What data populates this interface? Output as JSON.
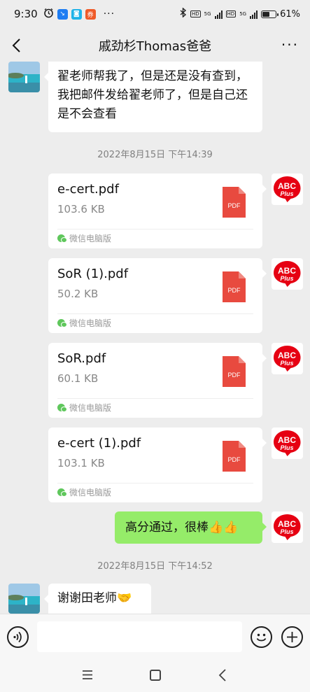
{
  "status_bar": {
    "time": "9:30",
    "battery_text": "61%",
    "battery_level": 0.61,
    "network_label": "5G",
    "hd_label": "HD"
  },
  "header": {
    "title": "戚劲杉Thomas爸爸"
  },
  "messages": {
    "first_text": "翟老师帮我了，但是还是没有查到，我把邮件发给翟老师了，但是自己还是不会查看",
    "time_1": "2022年8月15日 下午14:39",
    "files": [
      {
        "name": "e-cert.pdf",
        "size": "103.6 KB",
        "source": "微信电脑版",
        "icon_label": "PDF"
      },
      {
        "name": "SoR (1).pdf",
        "size": "50.2 KB",
        "source": "微信电脑版",
        "icon_label": "PDF"
      },
      {
        "name": "SoR.pdf",
        "size": "60.1 KB",
        "source": "微信电脑版",
        "icon_label": "PDF"
      },
      {
        "name": "e-cert (1).pdf",
        "size": "103.1 KB",
        "source": "微信电脑版",
        "icon_label": "PDF"
      }
    ],
    "sent_text": "高分通过，很棒👍👍",
    "time_2": "2022年8月15日 下午14:52",
    "last_text": "谢谢田老师🤝"
  },
  "avatar_logo": {
    "line1": "ABC",
    "line2": "Plus",
    "color": "#e60012"
  },
  "colors": {
    "background": "#ededed",
    "sent_bubble": "#95ec69",
    "pdf_red": "#e84a3f"
  }
}
